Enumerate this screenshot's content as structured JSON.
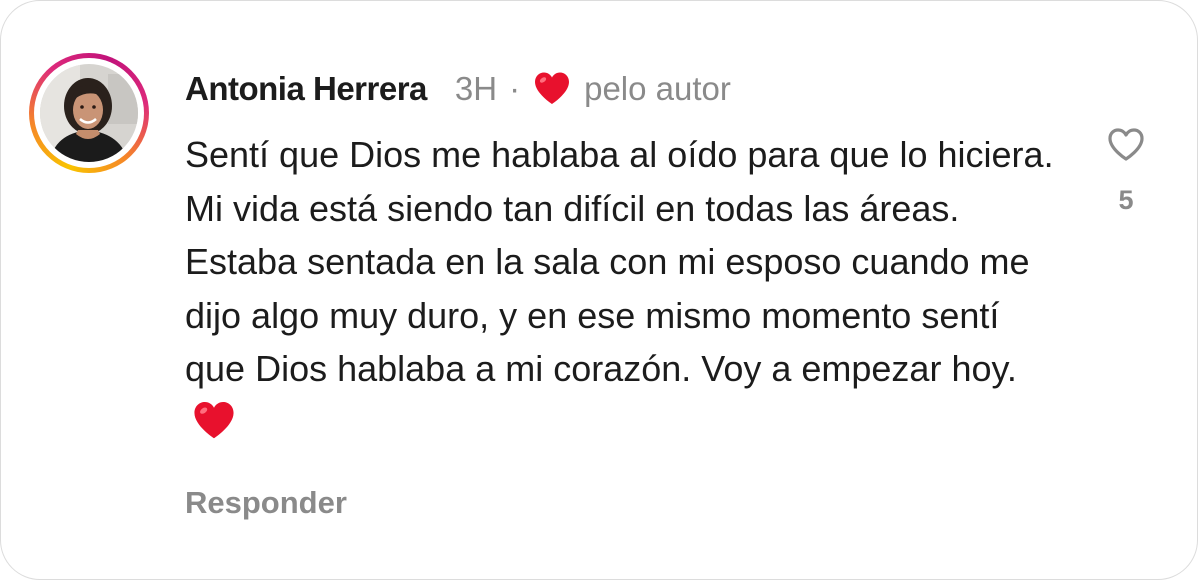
{
  "comment": {
    "author": "Antonia Herrera",
    "timestamp": "3H",
    "separator": "·",
    "author_like_text": "pelo autor",
    "text": "Sentí que Dios me hablaba al oído para que lo hiciera. Mi vida está siendo tan difícil en todas las áreas. Estaba sentada en la sala con mi esposo cuando me dijo algo muy duro, y en ese mismo momento sentí que Dios hablaba a mi corazón. Voy a empezar hoy.",
    "emoji": "red-heart-emoji",
    "reply_label": "Responder",
    "like_count": "5",
    "like_icon": "heart-outline-icon",
    "author_like_icon": "red-heart-icon"
  },
  "colors": {
    "text_primary": "#1c1c1c",
    "text_secondary": "#8a8a8a",
    "heart_red": "#e8112d",
    "ring_gradient": [
      "#f9c400",
      "#f58529",
      "#dd2a7b",
      "#c1127a"
    ]
  }
}
